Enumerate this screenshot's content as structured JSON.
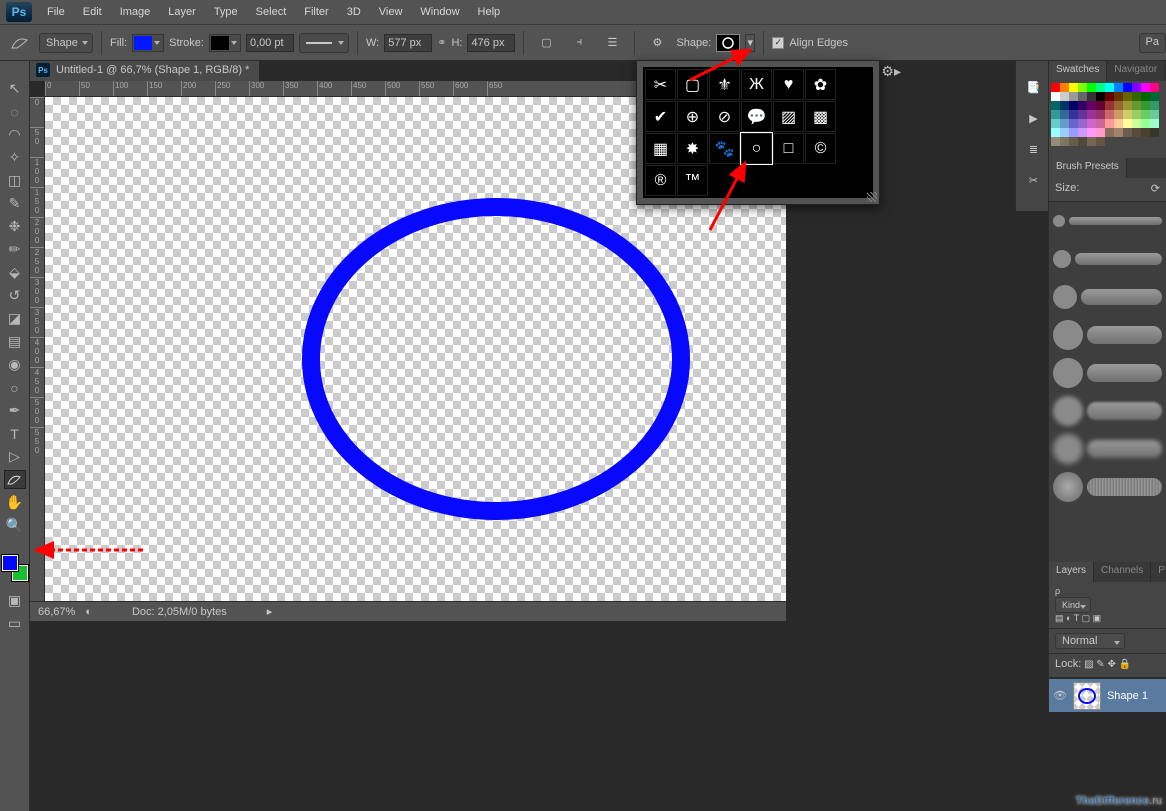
{
  "menu": [
    "File",
    "Edit",
    "Image",
    "Layer",
    "Type",
    "Select",
    "Filter",
    "3D",
    "View",
    "Window",
    "Help"
  ],
  "optbar": {
    "mode": "Shape",
    "fill_label": "Fill:",
    "fill_color": "#0019ff",
    "stroke_label": "Stroke:",
    "stroke_color": "#000000",
    "stroke_pt": "0,00 pt",
    "w_label": "W:",
    "w_value": "577 px",
    "h_label": "H:",
    "h_value": "476 px",
    "shape_label": "Shape:",
    "align_label": "Align Edges",
    "pa_button": "Pa"
  },
  "doc": {
    "title": "Untitled-1 @ 66,7% (Shape 1, RGB/8) *",
    "zoom": "66,67%",
    "docinfo": "Doc:  2,05M/0 bytes"
  },
  "hruler_ticks": [
    "0",
    "50",
    "100",
    "150",
    "200",
    "250",
    "300",
    "350",
    "400",
    "450",
    "500",
    "550",
    "600",
    "650"
  ],
  "vruler_ticks": [
    "0",
    "50",
    "100",
    "150",
    "200",
    "250",
    "300",
    "350",
    "400",
    "450",
    "500",
    "550"
  ],
  "circle_color": "#0808ff",
  "shape_picker": {
    "shapes": [
      "scissors",
      "square-outline",
      "fleur",
      "butterfly",
      "heart",
      "blob",
      "check",
      "crosshair",
      "no",
      "speech",
      "diag-hatch",
      "checker",
      "grid",
      "starburst",
      "paw",
      "circle-outline",
      "square-thin",
      "copyright",
      "registered",
      "tm"
    ]
  },
  "panels": {
    "swatches_tab": "Swatches",
    "navigator_tab": "Navigator",
    "brush_presets_tab": "Brush Presets",
    "size_label": "Size:",
    "layers_tab": "Layers",
    "channels_tab": "Channels",
    "paths_tab": "P",
    "kind_label": "Kind",
    "blend_mode": "Normal",
    "lock_label": "Lock:",
    "layer_name": "Shape 1"
  },
  "swatch_colors": [
    "#ff0000",
    "#ff8000",
    "#ffff00",
    "#80ff00",
    "#00ff00",
    "#00ff80",
    "#00ffff",
    "#0080ff",
    "#0000ff",
    "#8000ff",
    "#ff00ff",
    "#ff0080",
    "#ffffff",
    "#cccccc",
    "#999999",
    "#666666",
    "#333333",
    "#000000",
    "#660000",
    "#663300",
    "#666600",
    "#336600",
    "#006600",
    "#006633",
    "#006666",
    "#003366",
    "#000066",
    "#330066",
    "#660066",
    "#660033",
    "#993333",
    "#996633",
    "#999933",
    "#669933",
    "#339933",
    "#339966",
    "#339999",
    "#336699",
    "#333399",
    "#663399",
    "#993399",
    "#993366",
    "#cc6666",
    "#cc9966",
    "#cccc66",
    "#99cc66",
    "#66cc66",
    "#66cc99",
    "#66cccc",
    "#6699cc",
    "#6666cc",
    "#9966cc",
    "#cc66cc",
    "#cc6699",
    "#ff9999",
    "#ffcc99",
    "#ffff99",
    "#ccff99",
    "#99ff99",
    "#99ffcc",
    "#99ffff",
    "#99ccff",
    "#9999ff",
    "#cc99ff",
    "#ff99ff",
    "#ff99cc",
    "#8b6f5c",
    "#a0826d",
    "#6b5d4f",
    "#5a4a3c",
    "#494030",
    "#3b3428",
    "#948b7a",
    "#7d755f",
    "#665e4c",
    "#51493a",
    "#776655",
    "#665544"
  ],
  "watermark_a": "TheDifference",
  "watermark_b": ".ru"
}
